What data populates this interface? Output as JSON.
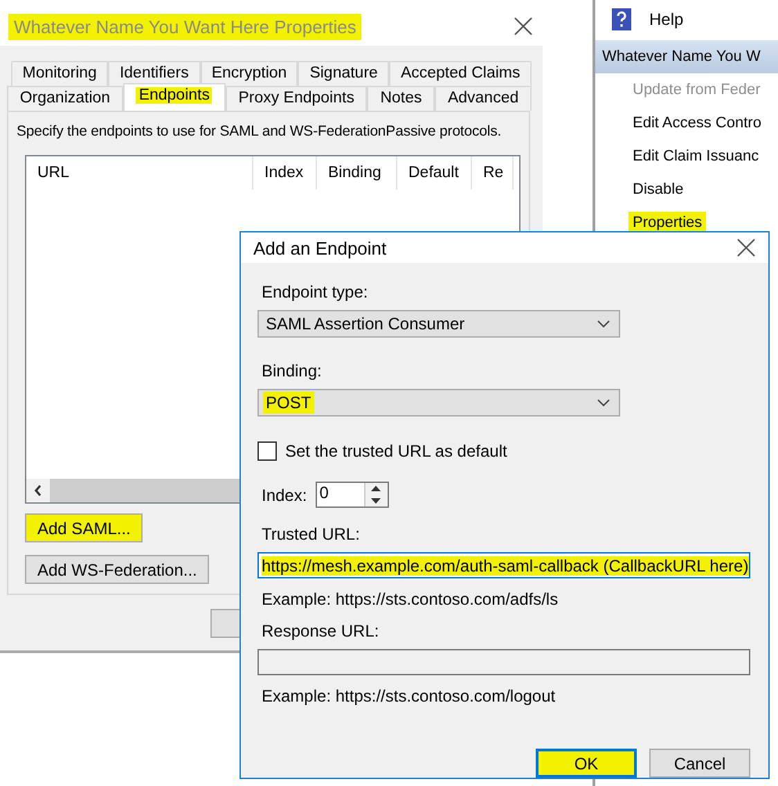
{
  "properties_window": {
    "title": "Whatever Name You Want Here Properties",
    "title_highlighted": true,
    "tab_rows": [
      [
        {
          "label": "Monitoring",
          "selected": false,
          "highlighted": false
        },
        {
          "label": "Identifiers",
          "selected": false,
          "highlighted": false
        },
        {
          "label": "Encryption",
          "selected": false,
          "highlighted": false
        },
        {
          "label": "Signature",
          "selected": false,
          "highlighted": false
        },
        {
          "label": "Accepted Claims",
          "selected": false,
          "highlighted": false
        }
      ],
      [
        {
          "label": "Organization",
          "selected": false,
          "highlighted": false
        },
        {
          "label": "Endpoints",
          "selected": true,
          "highlighted": true
        },
        {
          "label": "Proxy Endpoints",
          "selected": false,
          "highlighted": false
        },
        {
          "label": "Notes",
          "selected": false,
          "highlighted": false
        },
        {
          "label": "Advanced",
          "selected": false,
          "highlighted": false
        }
      ]
    ],
    "description": "Specify the endpoints to use for SAML and WS-FederationPassive protocols.",
    "table": {
      "columns": [
        "URL",
        "Index",
        "Binding",
        "Default",
        "Re"
      ]
    },
    "buttons": [
      {
        "label": "Add SAML...",
        "highlighted": true
      },
      {
        "label": "Add WS-Federation...",
        "highlighted": false
      }
    ]
  },
  "actions_pane": {
    "help": "Help",
    "header": "Whatever Name You W",
    "items": [
      {
        "label": "Update from Feder",
        "disabled": true,
        "highlighted": false
      },
      {
        "label": "Edit Access Contro",
        "disabled": false,
        "highlighted": false
      },
      {
        "label": "Edit Claim Issuanc",
        "disabled": false,
        "highlighted": false
      },
      {
        "label": "Disable",
        "disabled": false,
        "highlighted": false
      },
      {
        "label": "Properties",
        "disabled": false,
        "highlighted": true
      }
    ]
  },
  "dialog": {
    "title": "Add an Endpoint",
    "endpoint_type": {
      "label": "Endpoint type:",
      "value": "SAML Assertion Consumer",
      "highlighted": false
    },
    "binding": {
      "label": "Binding:",
      "value": "POST",
      "highlighted": true
    },
    "default_checkbox": {
      "label": "Set the trusted URL as default",
      "checked": false
    },
    "index": {
      "label": "Index:",
      "value": "0"
    },
    "trusted_url": {
      "label": "Trusted URL:",
      "value": "https://mesh.example.com/auth-saml-callback (CallbackURL here)",
      "highlighted": true,
      "example": "Example: https://sts.contoso.com/adfs/ls"
    },
    "response_url": {
      "label": "Response URL:",
      "example": "Example: https://sts.contoso.com/logout"
    },
    "buttons": [
      {
        "label": "OK",
        "default": true,
        "highlighted": true
      },
      {
        "label": "Cancel",
        "default": false,
        "highlighted": false
      }
    ]
  }
}
